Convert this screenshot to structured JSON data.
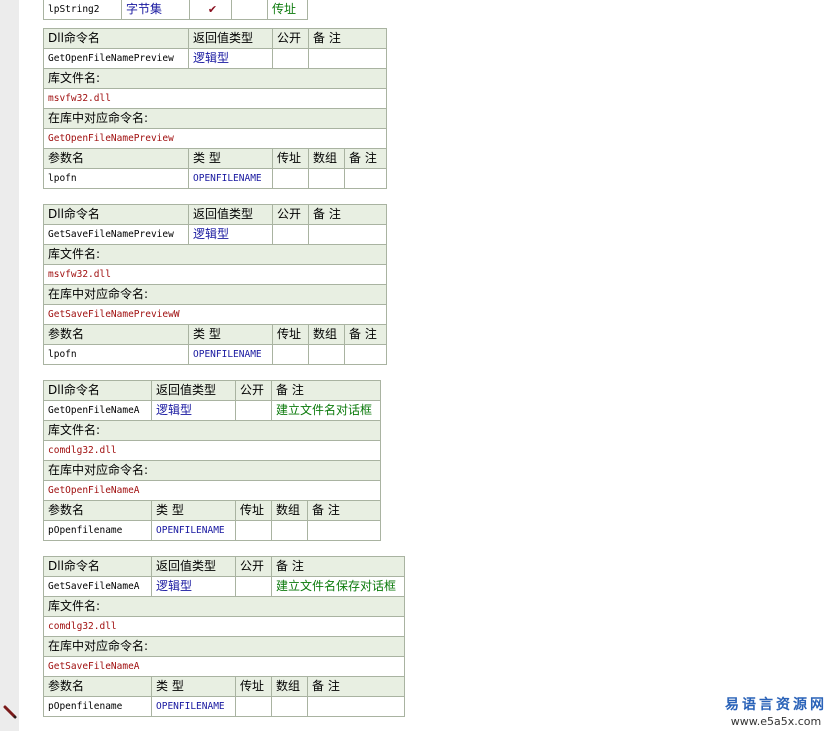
{
  "top_row": {
    "param": "lpString2",
    "type": "字节集",
    "check": "✔",
    "array": "",
    "note": "传址"
  },
  "labels": {
    "dll_cmd": "Dll命令名",
    "ret_type": "返回值类型",
    "public": "公开",
    "note": "备 注",
    "lib_file": "库文件名:",
    "lib_cmd": "在库中对应命令名:",
    "param_name": "参数名",
    "type": "类 型",
    "byref": "传址",
    "array": "数组"
  },
  "blocks": [
    {
      "name": "GetOpenFileNamePreview",
      "ret": "逻辑型",
      "public": "",
      "note": "",
      "lib": "msvfw32.dll",
      "libcmd": "GetOpenFileNamePreview",
      "param": "lpofn",
      "ptype": "OPENFILENAME"
    },
    {
      "name": "GetSaveFileNamePreview",
      "ret": "逻辑型",
      "public": "",
      "note": "",
      "lib": "msvfw32.dll",
      "libcmd": "GetSaveFileNamePreviewW",
      "param": "lpofn",
      "ptype": "OPENFILENAME"
    },
    {
      "name": "GetOpenFileNameA",
      "ret": "逻辑型",
      "public": "",
      "note": "建立文件名对话框",
      "lib": "comdlg32.dll",
      "libcmd": "GetOpenFileNameA",
      "param": "pOpenfilename",
      "ptype": "OPENFILENAME"
    },
    {
      "name": "GetSaveFileNameA",
      "ret": "逻辑型",
      "public": "",
      "note": "建立文件名保存对话框",
      "lib": "comdlg32.dll",
      "libcmd": "GetSaveFileNameA",
      "param": "pOpenfilename",
      "ptype": "OPENFILENAME"
    }
  ],
  "watermark": {
    "title": "易语言资源网",
    "url": "www.e5a5x.com"
  },
  "colors": {
    "header_bg": "#e8efe2",
    "border": "#a9b3a1",
    "lib_text": "#a01010",
    "type_text": "#1818a0",
    "note_text": "#0b7a0b",
    "gutter": "#ececec"
  }
}
